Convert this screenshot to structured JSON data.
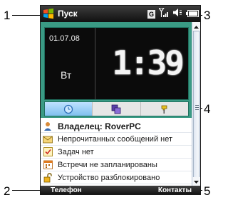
{
  "callouts": [
    "1",
    "2",
    "3",
    "4",
    "5"
  ],
  "titlebar": {
    "title": "Пуск",
    "gps_label": "G"
  },
  "clock": {
    "date": "01.07.08",
    "day": "Вт",
    "time": "1:39"
  },
  "tabs": [
    {
      "icon": "clock-icon",
      "active": true
    },
    {
      "icon": "windows-icon",
      "active": false
    },
    {
      "icon": "tools-icon",
      "active": false
    }
  ],
  "today": {
    "owner": "Владелец: RoverPC",
    "messages": "Непрочитанных сообщений нет",
    "tasks": "Задач нет",
    "calendar": "Встречи не запланированы",
    "lock": "Устройство разблокировано"
  },
  "softkeys": {
    "left": "Телефон",
    "right": "Контакты"
  },
  "colors": {
    "panel": "#3a9a84",
    "titlebar": "#101010",
    "clock_bg": "#0b0b0b"
  }
}
